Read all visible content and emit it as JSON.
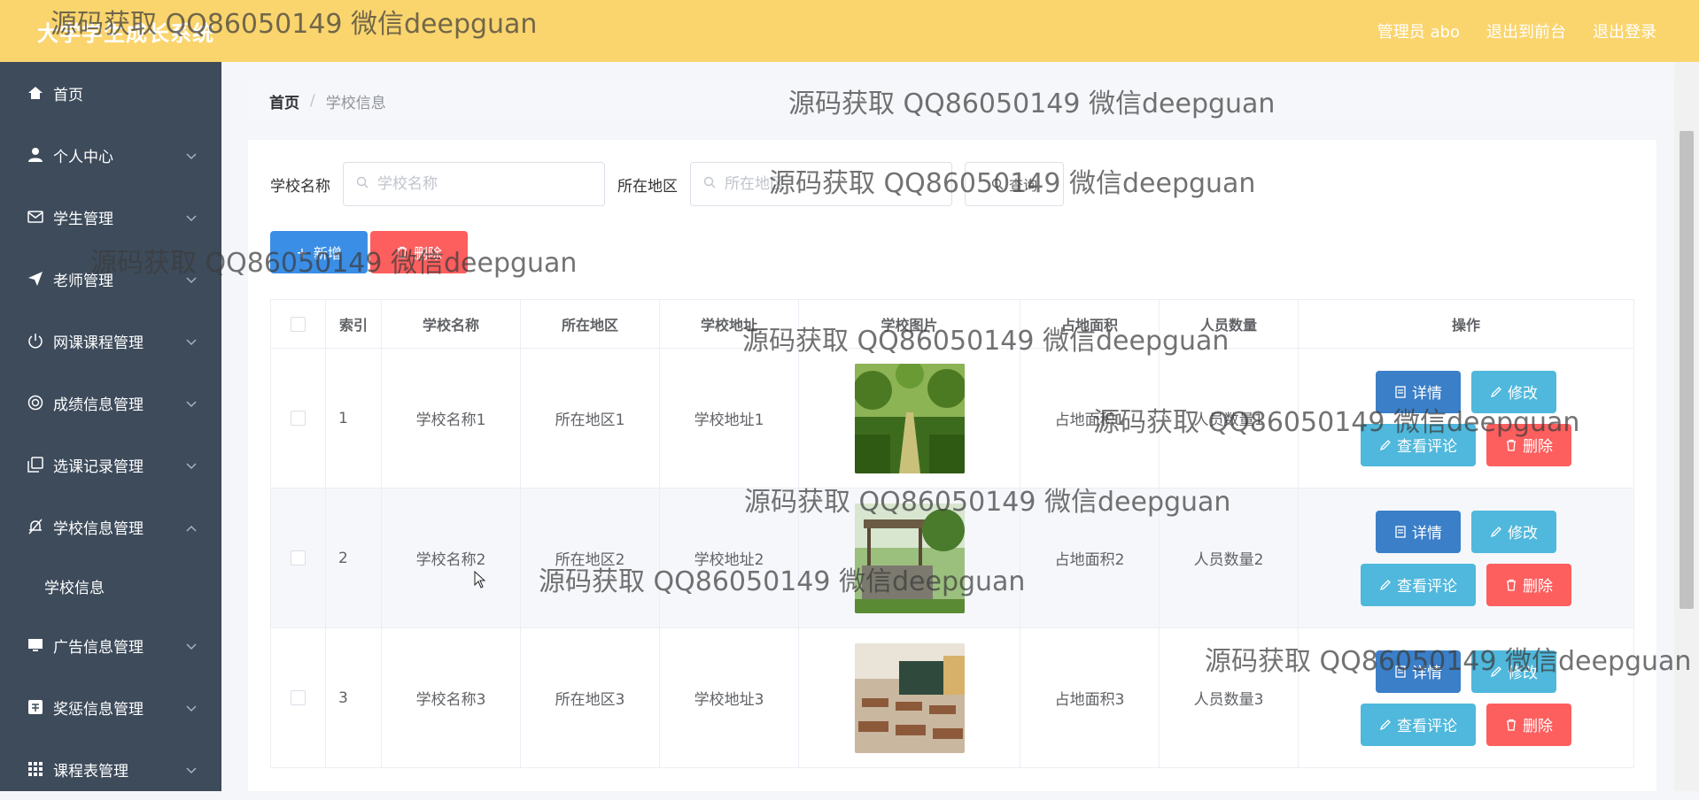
{
  "app": {
    "title": "大学学生成长系统"
  },
  "header": {
    "actions": [
      "管理员 abo",
      "退出到前台",
      "退出登录"
    ]
  },
  "sidebar": {
    "items": [
      {
        "label": "首页",
        "icon": "home-icon"
      },
      {
        "label": "个人中心",
        "icon": "user-icon"
      },
      {
        "label": "学生管理",
        "icon": "mail-icon"
      },
      {
        "label": "老师管理",
        "icon": "send-icon"
      },
      {
        "label": "网课课程管理",
        "icon": "power-icon"
      },
      {
        "label": "成绩信息管理",
        "icon": "target-icon"
      },
      {
        "label": "选课记录管理",
        "icon": "copy-icon"
      },
      {
        "label": "学校信息管理",
        "icon": "bell-off-icon",
        "expanded": true
      },
      {
        "label": "广告信息管理",
        "icon": "monitor-icon"
      },
      {
        "label": "奖惩信息管理",
        "icon": "ticket-icon"
      },
      {
        "label": "课程表管理",
        "icon": "grid-icon"
      }
    ],
    "subitem": "学校信息"
  },
  "breadcrumb": {
    "home": "首页",
    "separator": "/",
    "current": "学校信息"
  },
  "search": {
    "name_label": "学校名称",
    "name_placeholder": "学校名称",
    "region_label": "所在地区",
    "region_placeholder": "所在地区",
    "query_button": "查询"
  },
  "actions": {
    "add": "新增",
    "batch_delete": "删除"
  },
  "table": {
    "columns": [
      "索引",
      "学校名称",
      "所在地区",
      "学校地址",
      "学校图片",
      "占地面积",
      "人员数量",
      "操作"
    ],
    "rows": [
      {
        "index": "1",
        "name": "学校名称1",
        "region": "所在地区1",
        "address": "学校地址1",
        "area": "占地面积1",
        "people": "人员数量1"
      },
      {
        "index": "2",
        "name": "学校名称2",
        "region": "所在地区2",
        "address": "学校地址2",
        "area": "占地面积2",
        "people": "人员数量2"
      },
      {
        "index": "3",
        "name": "学校名称3",
        "region": "所在地区3",
        "address": "学校地址3",
        "area": "占地面积3",
        "people": "人员数量3"
      }
    ],
    "row_buttons": {
      "detail": "详情",
      "edit": "修改",
      "comment": "查看评论",
      "delete": "删除"
    }
  },
  "watermark": "源码获取 QQ86050149 微信deepguan",
  "colors": {
    "header": "#fad56e",
    "sidebar": "#3d4b5b",
    "primary": "#3a8ee6",
    "danger": "#fd5e5e",
    "info": "#4fb8dc"
  }
}
